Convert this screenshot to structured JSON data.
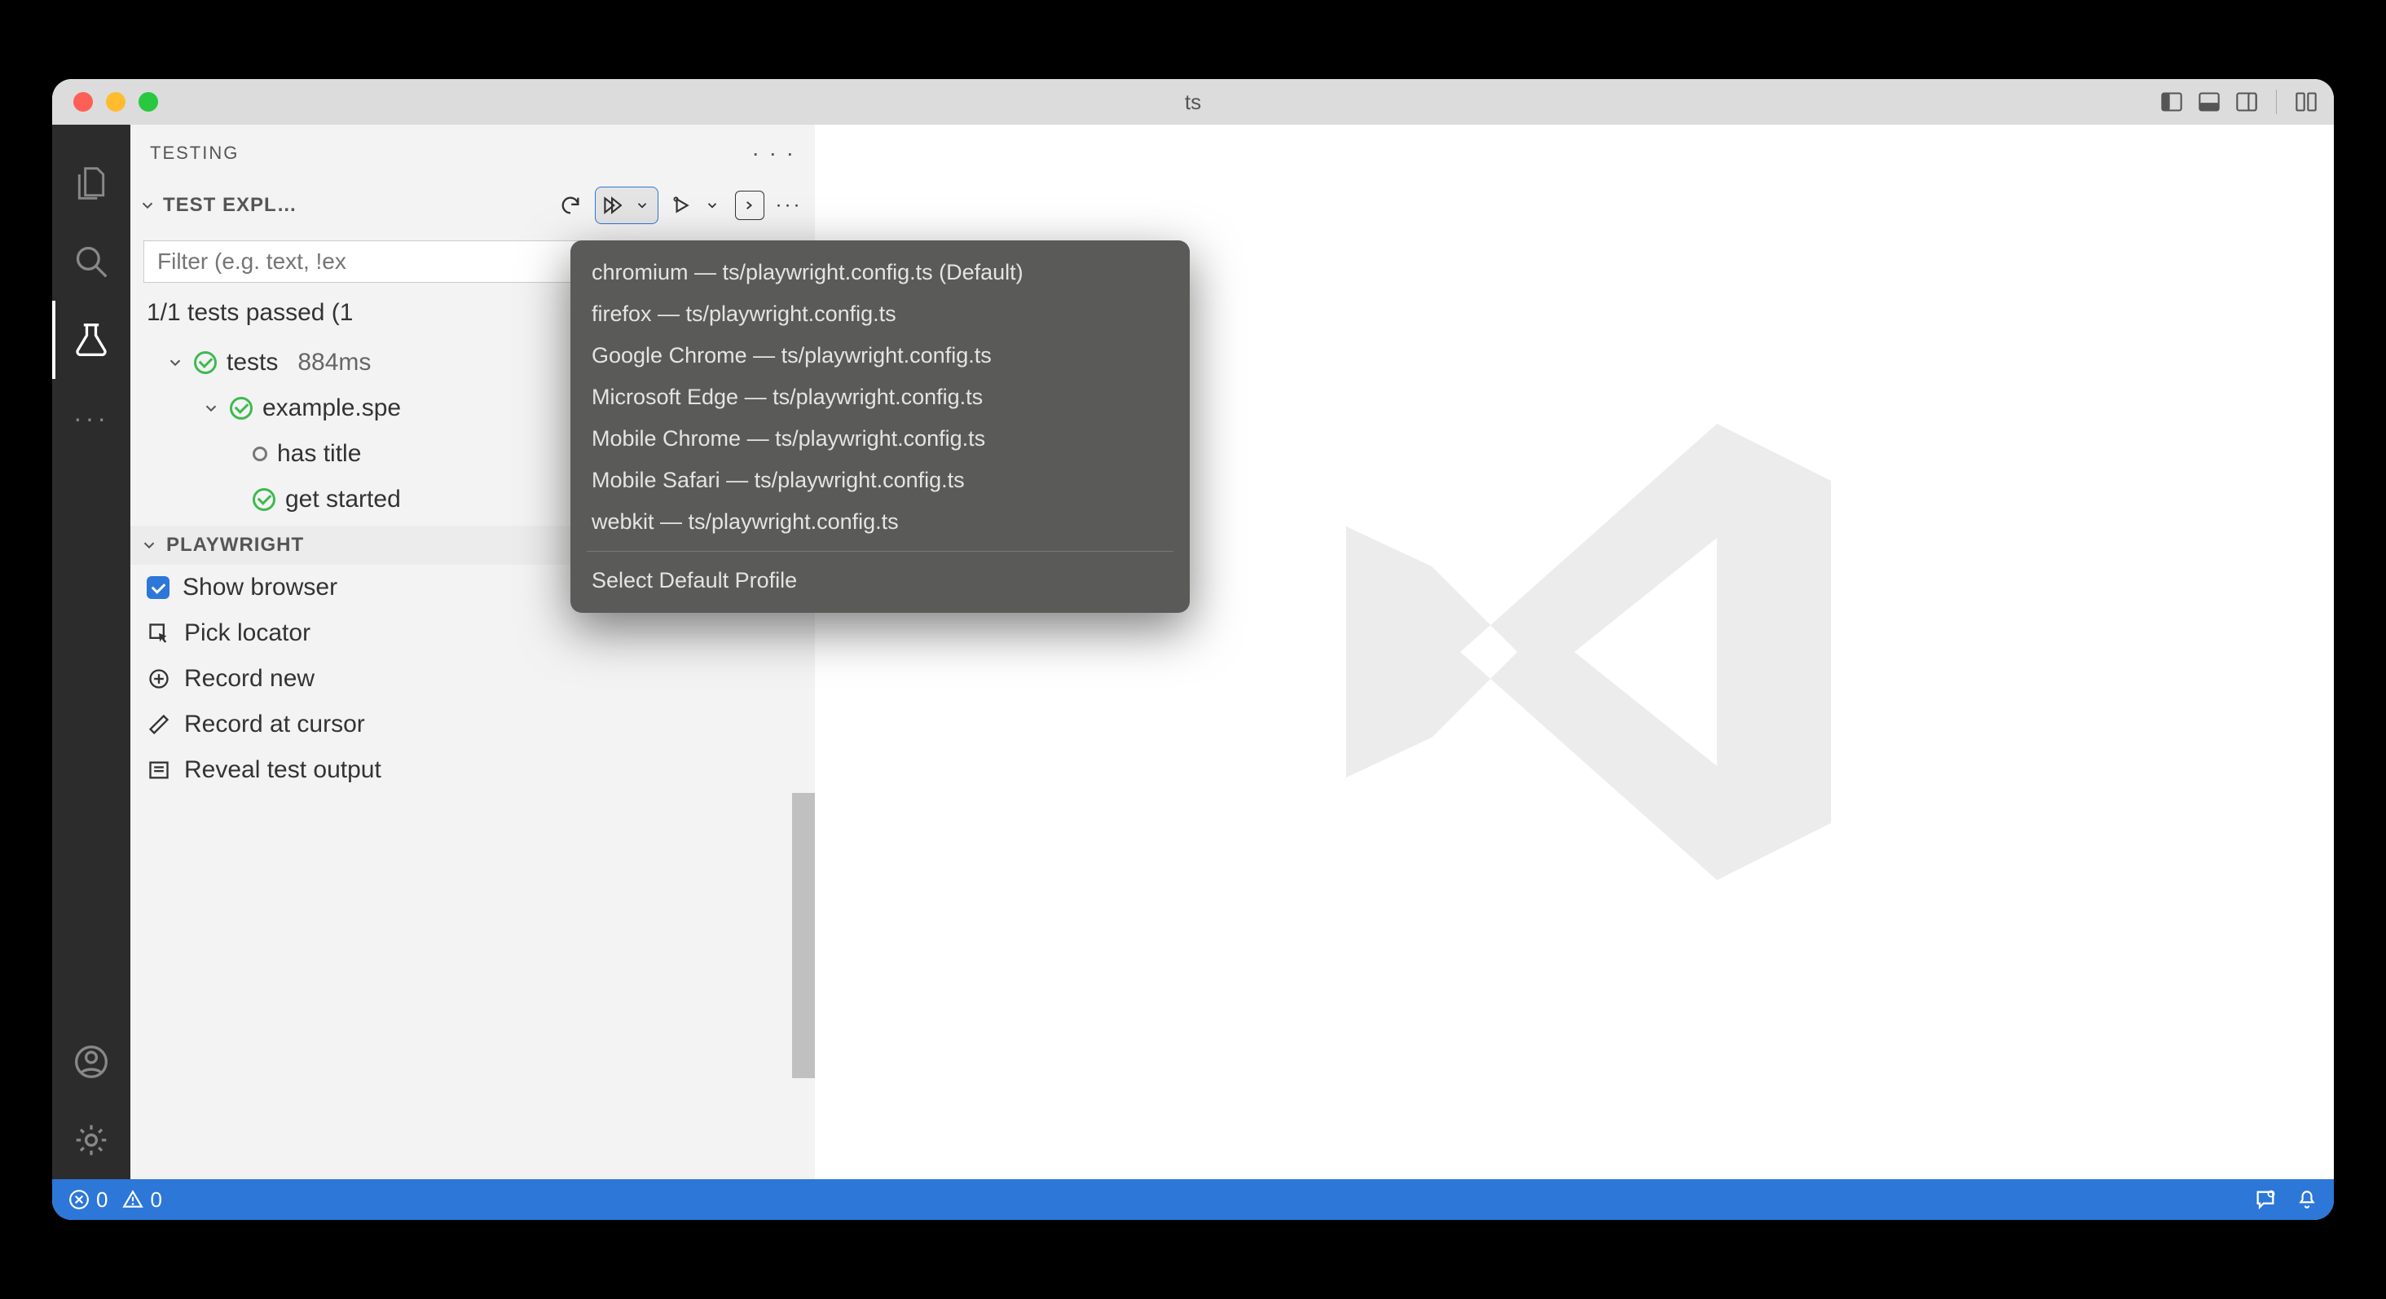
{
  "window": {
    "title": "ts"
  },
  "sidebar": {
    "header": "TESTING",
    "sections": {
      "explorer": {
        "title": "TEST EXPL…",
        "filter_placeholder": "Filter (e.g. text, !ex",
        "status": "1/1 tests passed (1",
        "tree": {
          "root": {
            "label": "tests",
            "duration": "884ms"
          },
          "file": {
            "label": "example.spe"
          },
          "test1": {
            "label": "has title"
          },
          "test2": {
            "label": "get started"
          }
        }
      },
      "playwright": {
        "title": "PLAYWRIGHT",
        "items": {
          "show_browser": "Show browser",
          "pick_locator": "Pick locator",
          "record_new": "Record new",
          "record_cursor": "Record at cursor",
          "reveal_output": "Reveal test output"
        }
      }
    }
  },
  "menu": {
    "items": [
      "chromium — ts/playwright.config.ts (Default)",
      "firefox — ts/playwright.config.ts",
      "Google Chrome — ts/playwright.config.ts",
      "Microsoft Edge — ts/playwright.config.ts",
      "Mobile Chrome — ts/playwright.config.ts",
      "Mobile Safari — ts/playwright.config.ts",
      "webkit — ts/playwright.config.ts"
    ],
    "footer": "Select Default Profile"
  },
  "statusbar": {
    "errors": "0",
    "warnings": "0"
  }
}
